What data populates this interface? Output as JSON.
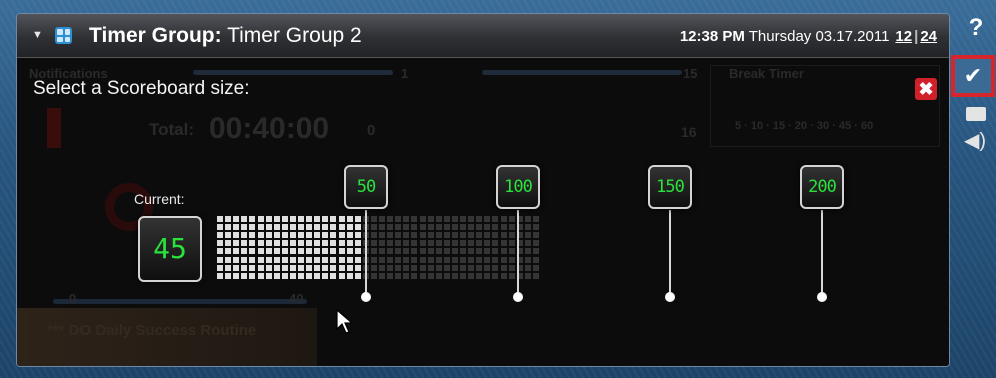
{
  "window": {
    "title_prefix": "Timer Group:",
    "title_value": "Timer Group 2",
    "time": "12:38 PM",
    "date": "Thursday 03.17.2011",
    "format_12": "12",
    "format_sep": "|",
    "format_24": "24"
  },
  "background": {
    "notifications": "Notifications",
    "num1": "1",
    "num15": "15",
    "break_timer": "Break Timer",
    "total_label": "Total:",
    "total_time": "00:40:00",
    "total_count": "0",
    "num16": "16",
    "break_options": "5 · 10 · 15 · 20 · 30 · 45 · 60",
    "slider_min": "0",
    "slider_max": "40",
    "routine": "*** DO Daily Success Routine"
  },
  "dialog": {
    "title": "Select a Scoreboard size:",
    "close": "✖",
    "current_label": "Current:",
    "current_value": "45",
    "options": [
      "50",
      "100",
      "150",
      "200"
    ],
    "grid": {
      "total_columns": 40,
      "rows": 8,
      "filled_columns": 18
    },
    "colors": {
      "digit": "#29e23c",
      "filled": "#e0e0e0",
      "empty": "#353535"
    }
  },
  "sidebar": {
    "help": "?",
    "check": "✔"
  }
}
